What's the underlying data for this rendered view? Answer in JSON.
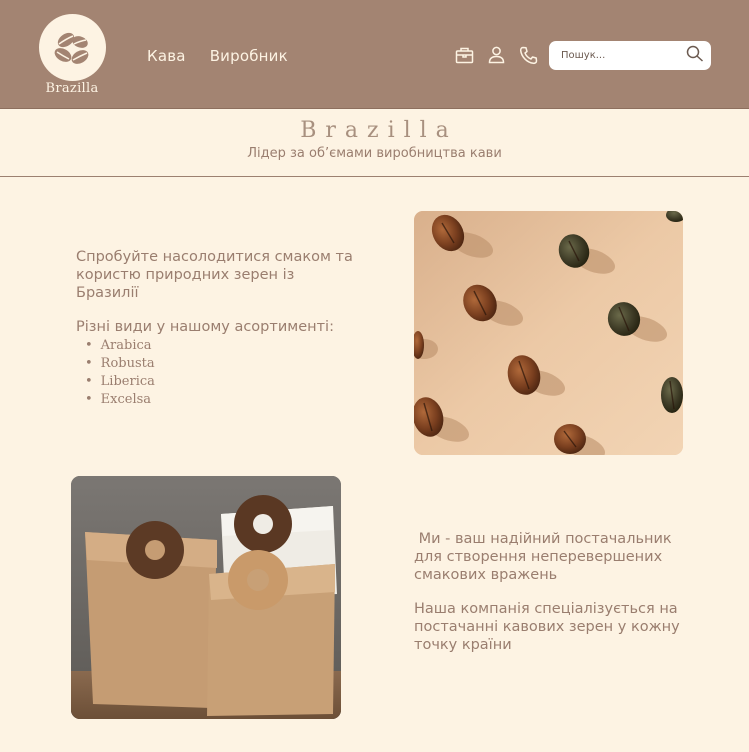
{
  "header": {
    "logo_text": "Brazilla",
    "nav": [
      "Кава",
      "Виробник"
    ],
    "icons": [
      "cart-icon",
      "user-icon",
      "phone-icon"
    ],
    "search": {
      "placeholder": "Пошук..."
    }
  },
  "hero": {
    "title": "Brazilla",
    "subtitle": "Лідер за об’ємами виробництва кави"
  },
  "section1": {
    "intro": "Спробуйте насолодитися смаком та користю природних зерен із Бразилії",
    "varieties_heading": "Різні види у нашому асортименті:",
    "varieties": [
      "Arabica",
      "Robusta",
      "Liberica",
      "Excelsa"
    ]
  },
  "section2": {
    "line1": " Ми - ваш надійний постачальник для створення неперевершених смакових вражень",
    "line2": "Наша компанія спеціалізується на постачанні кавових зерен у кожну точку країни"
  },
  "colors": {
    "header_bg": "#a38472",
    "page_bg": "#fdf3e3",
    "text": "#9a7e6f"
  }
}
